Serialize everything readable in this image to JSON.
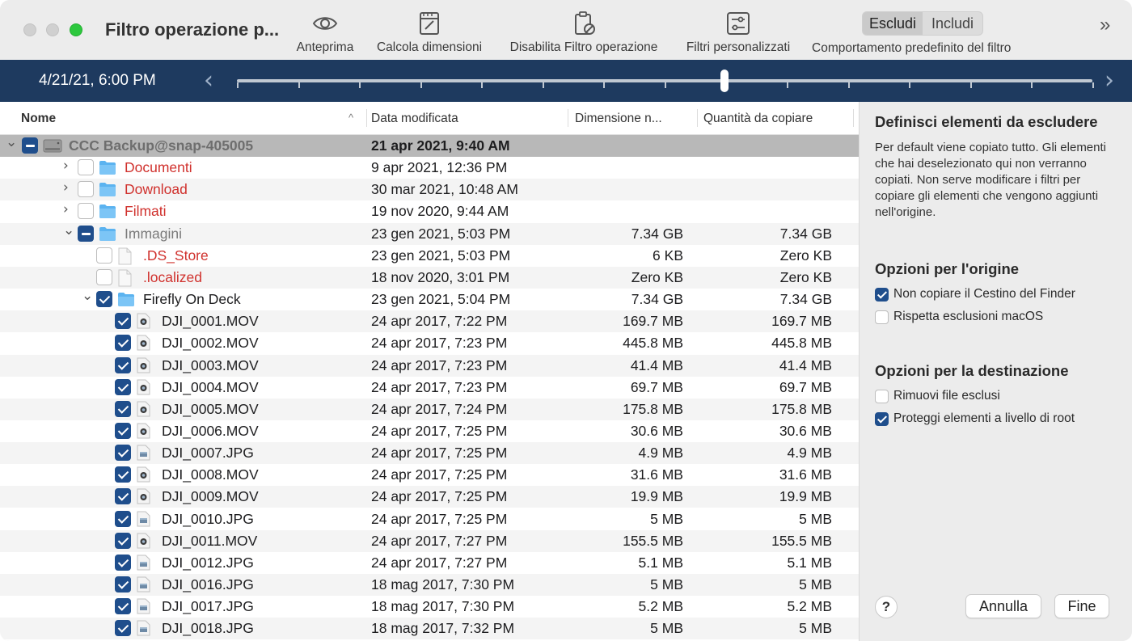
{
  "window": {
    "title": "Filtro operazione p..."
  },
  "toolbar": {
    "preview": "Anteprima",
    "calc": "Calcola dimensioni",
    "disable": "Disabilita Filtro operazione",
    "custom": "Filtri personalizzati",
    "segment": {
      "exclude": "Escludi",
      "include": "Includi",
      "caption": "Comportamento predefinito del filtro"
    },
    "more": "»"
  },
  "timeline": {
    "date": "4/21/21, 6:00 PM",
    "prev": "‹",
    "next": "›",
    "position": 0.57
  },
  "columns": {
    "name": "Nome",
    "date": "Data modificata",
    "size": "Dimensione n...",
    "copy": "Quantità da copiare",
    "sort_indicator": "^"
  },
  "rows": [
    {
      "indent": 0,
      "disc": "open",
      "check": "mixed",
      "icon": "disk-icon",
      "name": "CCC Backup@snap-405005",
      "style": "rootname",
      "date": "21 apr 2021, 9:40 AM",
      "date_bold": true,
      "size": "",
      "copy": ""
    },
    {
      "indent": 1,
      "disc": "closed",
      "check": "none",
      "icon": "folder-icon",
      "name": "Documenti",
      "style": "red",
      "date": "9 apr 2021, 12:36 PM",
      "size": "",
      "copy": ""
    },
    {
      "indent": 1,
      "disc": "closed",
      "check": "none",
      "icon": "folder-icon",
      "name": "Download",
      "style": "red",
      "date": "30 mar 2021, 10:48 AM",
      "size": "",
      "copy": ""
    },
    {
      "indent": 1,
      "disc": "closed",
      "check": "none",
      "icon": "folder-icon",
      "name": "Filmati",
      "style": "red",
      "date": "19 nov 2020, 9:44 AM",
      "size": "",
      "copy": ""
    },
    {
      "indent": 1,
      "disc": "open",
      "check": "mixed",
      "icon": "folder-icon",
      "name": "Immagini",
      "style": "gray",
      "date": "23 gen 2021, 5:03 PM",
      "size": "7.34 GB",
      "copy": "7.34 GB"
    },
    {
      "indent": 2,
      "disc": "",
      "check": "none",
      "icon": "doc-icon",
      "name": ".DS_Store",
      "style": "red",
      "date": "23 gen 2021, 5:03 PM",
      "size": "6 KB",
      "copy": "Zero KB"
    },
    {
      "indent": 2,
      "disc": "",
      "check": "none",
      "icon": "doc-icon",
      "name": ".localized",
      "style": "red",
      "date": "18 nov 2020, 3:01 PM",
      "size": "Zero KB",
      "copy": "Zero KB"
    },
    {
      "indent": 2,
      "disc": "open",
      "check": "checked",
      "icon": "folder-icon",
      "name": "Firefly On Deck",
      "style": "dark",
      "date": "23 gen 2021, 5:04 PM",
      "size": "7.34 GB",
      "copy": "7.34 GB"
    },
    {
      "indent": 3,
      "disc": "",
      "check": "checked",
      "icon": "movie-icon",
      "name": "DJI_0001.MOV",
      "style": "dark",
      "date": "24 apr 2017, 7:22 PM",
      "size": "169.7 MB",
      "copy": "169.7 MB"
    },
    {
      "indent": 3,
      "disc": "",
      "check": "checked",
      "icon": "movie-icon",
      "name": "DJI_0002.MOV",
      "style": "dark",
      "date": "24 apr 2017, 7:23 PM",
      "size": "445.8 MB",
      "copy": "445.8 MB"
    },
    {
      "indent": 3,
      "disc": "",
      "check": "checked",
      "icon": "movie-icon",
      "name": "DJI_0003.MOV",
      "style": "dark",
      "date": "24 apr 2017, 7:23 PM",
      "size": "41.4 MB",
      "copy": "41.4 MB"
    },
    {
      "indent": 3,
      "disc": "",
      "check": "checked",
      "icon": "movie-icon",
      "name": "DJI_0004.MOV",
      "style": "dark",
      "date": "24 apr 2017, 7:23 PM",
      "size": "69.7 MB",
      "copy": "69.7 MB"
    },
    {
      "indent": 3,
      "disc": "",
      "check": "checked",
      "icon": "movie-icon",
      "name": "DJI_0005.MOV",
      "style": "dark",
      "date": "24 apr 2017, 7:24 PM",
      "size": "175.8 MB",
      "copy": "175.8 MB"
    },
    {
      "indent": 3,
      "disc": "",
      "check": "checked",
      "icon": "movie-icon",
      "name": "DJI_0006.MOV",
      "style": "dark",
      "date": "24 apr 2017, 7:25 PM",
      "size": "30.6 MB",
      "copy": "30.6 MB"
    },
    {
      "indent": 3,
      "disc": "",
      "check": "checked",
      "icon": "image-icon",
      "name": "DJI_0007.JPG",
      "style": "dark",
      "date": "24 apr 2017, 7:25 PM",
      "size": "4.9 MB",
      "copy": "4.9 MB"
    },
    {
      "indent": 3,
      "disc": "",
      "check": "checked",
      "icon": "movie-icon",
      "name": "DJI_0008.MOV",
      "style": "dark",
      "date": "24 apr 2017, 7:25 PM",
      "size": "31.6 MB",
      "copy": "31.6 MB"
    },
    {
      "indent": 3,
      "disc": "",
      "check": "checked",
      "icon": "movie-icon",
      "name": "DJI_0009.MOV",
      "style": "dark",
      "date": "24 apr 2017, 7:25 PM",
      "size": "19.9 MB",
      "copy": "19.9 MB"
    },
    {
      "indent": 3,
      "disc": "",
      "check": "checked",
      "icon": "image-icon",
      "name": "DJI_0010.JPG",
      "style": "dark",
      "date": "24 apr 2017, 7:25 PM",
      "size": "5 MB",
      "copy": "5 MB"
    },
    {
      "indent": 3,
      "disc": "",
      "check": "checked",
      "icon": "movie-icon",
      "name": "DJI_0011.MOV",
      "style": "dark",
      "date": "24 apr 2017, 7:27 PM",
      "size": "155.5 MB",
      "copy": "155.5 MB"
    },
    {
      "indent": 3,
      "disc": "",
      "check": "checked",
      "icon": "image-icon",
      "name": "DJI_0012.JPG",
      "style": "dark",
      "date": "24 apr 2017, 7:27 PM",
      "size": "5.1 MB",
      "copy": "5.1 MB"
    },
    {
      "indent": 3,
      "disc": "",
      "check": "checked",
      "icon": "image-icon",
      "name": "DJI_0016.JPG",
      "style": "dark",
      "date": "18 mag 2017, 7:30 PM",
      "size": "5 MB",
      "copy": "5 MB"
    },
    {
      "indent": 3,
      "disc": "",
      "check": "checked",
      "icon": "image-icon",
      "name": "DJI_0017.JPG",
      "style": "dark",
      "date": "18 mag 2017, 7:30 PM",
      "size": "5.2 MB",
      "copy": "5.2 MB"
    },
    {
      "indent": 3,
      "disc": "",
      "check": "checked",
      "icon": "image-icon",
      "name": "DJI_0018.JPG",
      "style": "dark",
      "date": "18 mag 2017, 7:32 PM",
      "size": "5 MB",
      "copy": "5 MB"
    }
  ],
  "panel": {
    "heading": "Definisci elementi da escludere",
    "description": "Per default viene copiato tutto. Gli elementi che hai deselezionato qui non verranno copiati. Non serve modificare i filtri per copiare gli elementi che vengono aggiunti nell'origine.",
    "source_heading": "Opzioni per l'origine",
    "source_options": [
      {
        "label": "Non copiare il Cestino del Finder",
        "checked": true
      },
      {
        "label": "Rispetta esclusioni macOS",
        "checked": false
      }
    ],
    "dest_heading": "Opzioni per la destinazione",
    "dest_options": [
      {
        "label": "Rimuovi file esclusi",
        "checked": false
      },
      {
        "label": "Proteggi elementi a livello di root",
        "checked": true
      }
    ],
    "help": "?",
    "cancel": "Annulla",
    "done": "Fine"
  },
  "colors": {
    "accent": "#1f4e8c",
    "timeline": "#1e3a5f",
    "excluded": "#d0312d"
  }
}
